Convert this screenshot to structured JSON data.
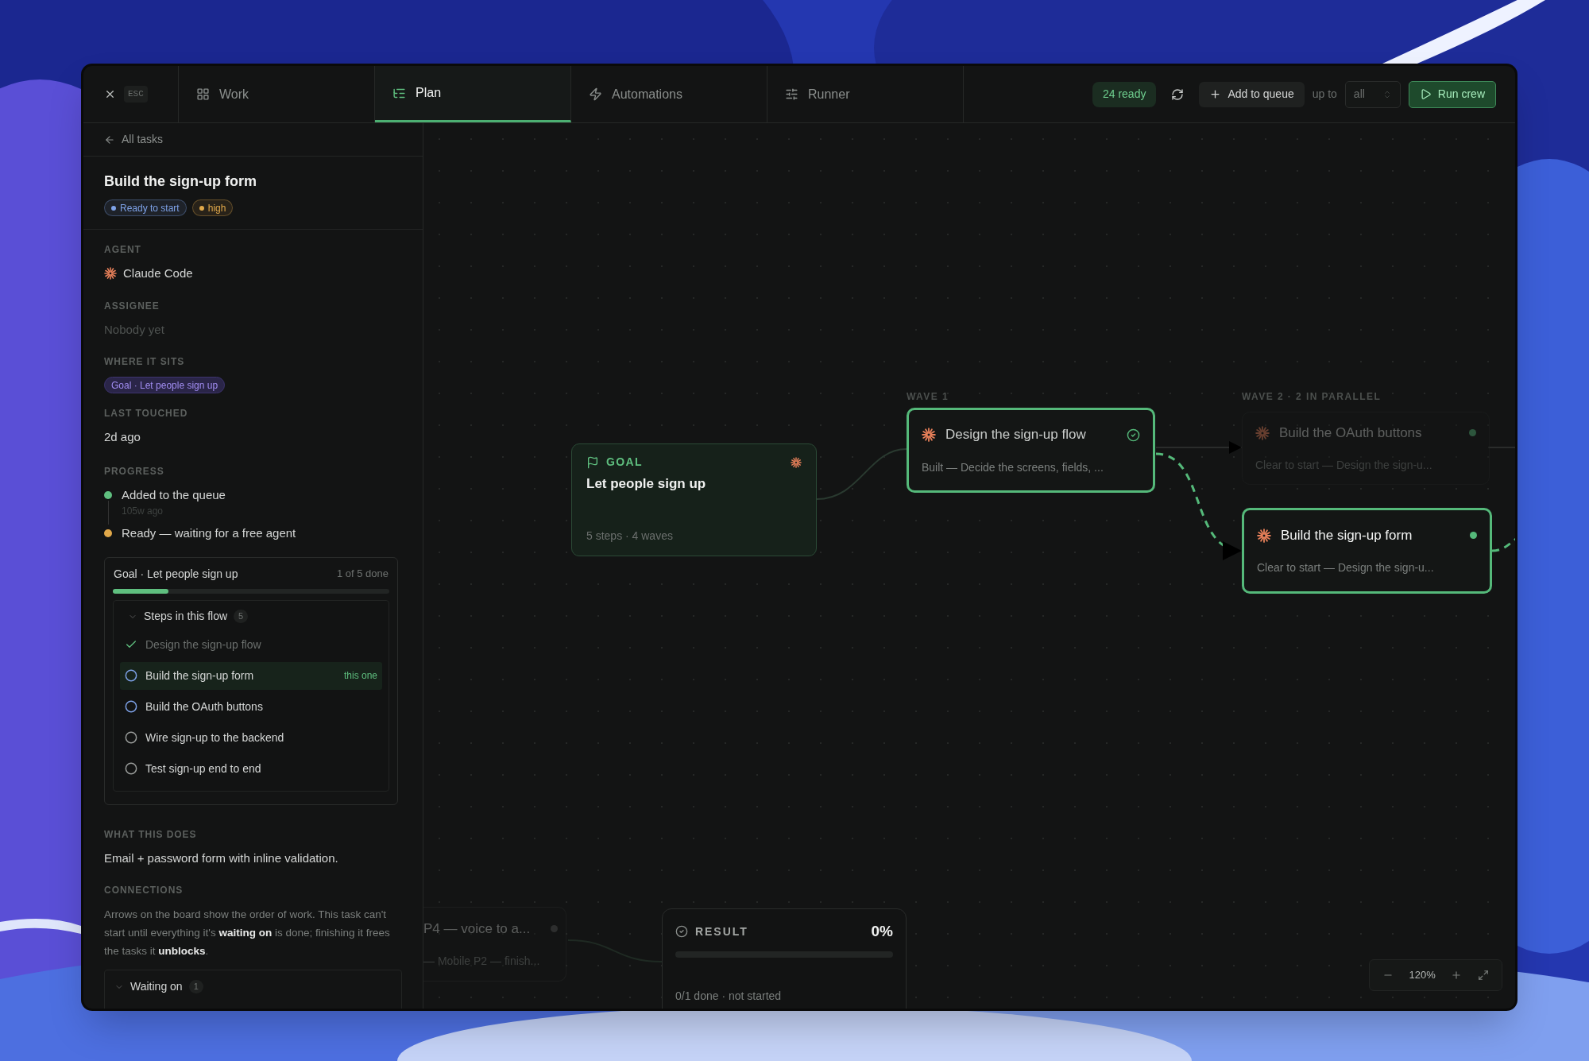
{
  "toolbar": {
    "esc": "ESC",
    "tabs": [
      {
        "label": "Work",
        "selected": false
      },
      {
        "label": "Plan",
        "selected": true
      },
      {
        "label": "Automations",
        "selected": false
      },
      {
        "label": "Runner",
        "selected": false
      }
    ],
    "ready": "24 ready",
    "add_button": "Add to queue",
    "limit_label": "up to",
    "limit_value": "all",
    "run_button": "Run crew"
  },
  "task": {
    "back_link": "All tasks",
    "title": "Build the sign-up form",
    "badges": [
      {
        "label": "Ready to start",
        "color": "#7ea2e8"
      },
      {
        "label": "high",
        "color": "#e0a84a"
      }
    ],
    "agent_label": "AGENT",
    "agent": "Claude Code",
    "assignee_label": "ASSIGNEE",
    "assignee": "Nobody yet",
    "where_label": "WHERE IT SITS",
    "where": "Goal · Let people sign up",
    "touched_label": "LAST TOUCHED",
    "touched": "2d ago",
    "progress_label": "PROGRESS",
    "progress": [
      {
        "text": "Added to the queue",
        "time": "105w ago",
        "color": "#5fbf7f"
      },
      {
        "text": "Ready — waiting for a free agent",
        "color": "#e0a84a"
      }
    ],
    "flow": {
      "title": "Goal · Let people sign up",
      "count": "1 of 5 done",
      "level": 0.2,
      "steps_label": "Steps in this flow",
      "steps_count": "5",
      "expanded": true,
      "steps": [
        {
          "label": "Design the sign-up flow",
          "kind": "done",
          "selected": false
        },
        {
          "label": "Build the sign-up form",
          "kind": "ready",
          "selected": true,
          "tag": "this one"
        },
        {
          "label": "Build the OAuth buttons",
          "kind": "ready",
          "selected": false
        },
        {
          "label": "Wire sign-up to the backend",
          "kind": "waiting",
          "selected": false
        },
        {
          "label": "Test sign-up end to end",
          "kind": "waiting",
          "selected": false
        }
      ]
    },
    "what_label": "WHAT THIS DOES",
    "what": "Email + password form with inline validation.",
    "connections_label": "CONNECTIONS",
    "connections": "Arrows on the board show the order of work. This task can't start until everything it's **waiting on** is done; finishing it frees the tasks it **unblocks**.",
    "waiting": {
      "label": "Waiting on",
      "count": "1"
    }
  },
  "board": {
    "goal": {
      "label": "GOAL",
      "title": "Let people sign up",
      "meta": "5 steps · 4 waves"
    },
    "waves": [
      {
        "label": "WAVE 1"
      },
      {
        "label": "WAVE 2 · 2 IN PARALLEL"
      }
    ],
    "tasks": [
      {
        "title": "Design the sign-up flow",
        "subtitle": "Built — Decide the screens, fields, ...",
        "kind": "done",
        "selected": false,
        "dimmed": false
      },
      {
        "title": "Build the OAuth buttons",
        "subtitle": "Clear to start — Design the sign-u...",
        "kind": "ready",
        "selected": false,
        "dimmed": true
      },
      {
        "title": "Build the sign-up form",
        "subtitle": "Clear to start — Design the sign-u...",
        "kind": "ready",
        "selected": true,
        "dimmed": false
      },
      {
        "title": "P4 — voice to a...",
        "subtitle": "— Mobile P2 — finish...",
        "kind": "waiting",
        "selected": false,
        "dimmed": true
      }
    ],
    "result": {
      "label": "RESULT",
      "percent": "0%",
      "level": 0,
      "meta": "0/1 done · not started"
    },
    "zoom": {
      "value": "120%"
    }
  }
}
